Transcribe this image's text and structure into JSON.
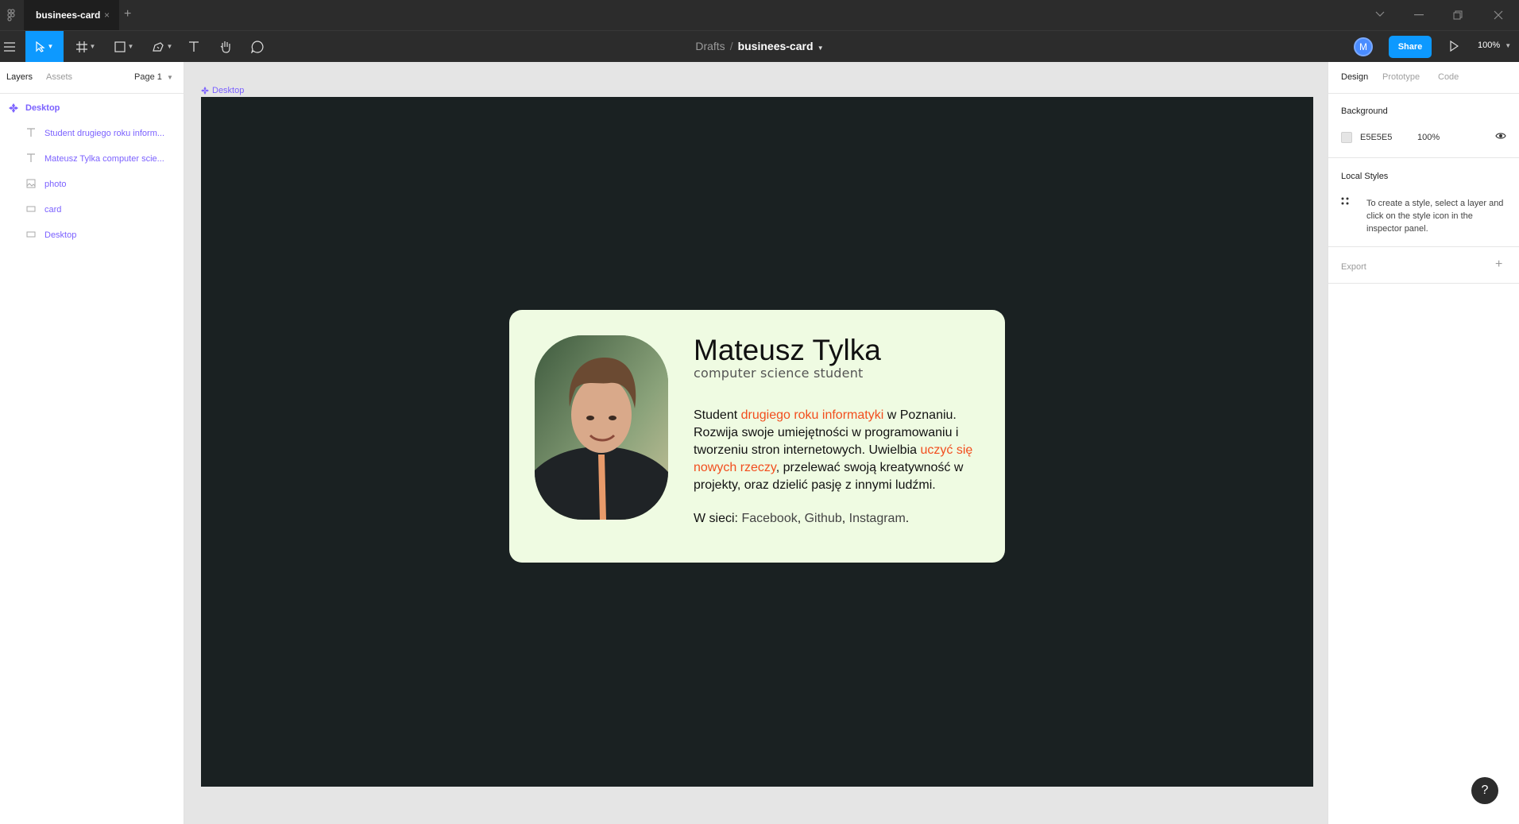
{
  "titlebar": {
    "tab_label": "businees-card",
    "tab_close": "×",
    "tab_add": "+"
  },
  "toolbar": {
    "breadcrumb_parent": "Drafts",
    "breadcrumb_sep": "/",
    "file_name": "businees-card",
    "avatar_initial": "M",
    "share_label": "Share",
    "zoom": "100%"
  },
  "left_panel": {
    "tabs": [
      "Layers",
      "Assets"
    ],
    "page": "Page 1",
    "layers": [
      {
        "label": "Desktop",
        "icon": "frame-icon"
      },
      {
        "label": "Student drugiego roku inform...",
        "icon": "text-layer-icon"
      },
      {
        "label": "Mateusz Tylka computer scie...",
        "icon": "text-layer-icon"
      },
      {
        "label": "photo",
        "icon": "image-layer-icon"
      },
      {
        "label": "card",
        "icon": "rectangle-layer-icon"
      },
      {
        "label": "Desktop",
        "icon": "rectangle-layer-icon"
      }
    ]
  },
  "canvas": {
    "frame_label": "Desktop",
    "frame_color": "#1a2122",
    "card": {
      "name": "Mateusz Tylka",
      "subtitle": "computer science student",
      "desc_1": "Student ",
      "desc_hl_1": "drugiego roku informatyki",
      "desc_2": " w Poznaniu. Rozwija swoje umiejętności w programowaniu i tworzeniu stron internetowych. Uwielbia ",
      "desc_hl_2": "uczyć się nowych rzeczy",
      "desc_3": ", przelewać swoją kreatywność w projekty, oraz dzielić pasję z innymi ludźmi.",
      "links_prefix": "W sieci: ",
      "links": [
        "Facebook",
        "Github",
        "Instagram"
      ],
      "sep_1": ", ",
      "sep_2": ", ",
      "links_end": ".",
      "card_color": "#effbe2",
      "highlight_color": "#f24e1e"
    }
  },
  "right_panel": {
    "tabs": [
      "Design",
      "Prototype",
      "Code"
    ],
    "background_title": "Background",
    "background_hex": "E5E5E5",
    "background_opacity": "100%",
    "local_styles_title": "Local Styles",
    "local_styles_help": "To create a style, select a layer and click on the style icon in the inspector panel.",
    "export_title": "Export",
    "export_add": "+"
  },
  "help_label": "?"
}
